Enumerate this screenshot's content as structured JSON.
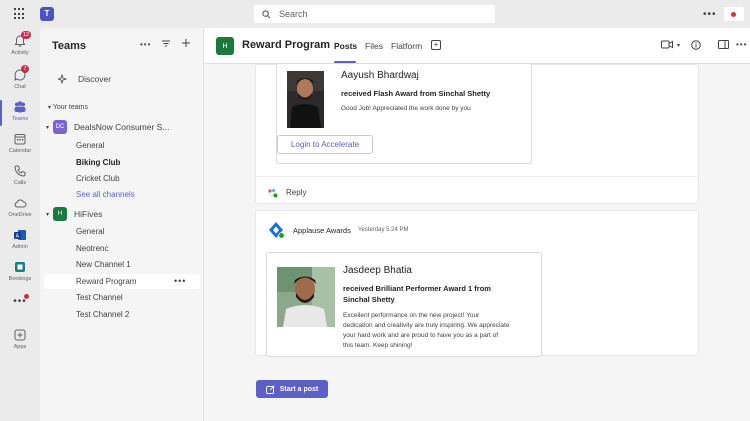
{
  "search": {
    "placeholder": "Search"
  },
  "rail": [
    {
      "label": "Activity",
      "badge": "12"
    },
    {
      "label": "Chat",
      "badge": "7"
    },
    {
      "label": "Teams"
    },
    {
      "label": "Calendar"
    },
    {
      "label": "Calls"
    },
    {
      "label": "OneDrive"
    },
    {
      "label": "Admin"
    },
    {
      "label": "Bookings"
    },
    {
      "label": "Apps"
    }
  ],
  "panel": {
    "title": "Teams",
    "discover": "Discover",
    "section_label": "Your teams",
    "teams": [
      {
        "name": "DealsNow Consumer S...",
        "initials": "DC",
        "color": "#7b61d6",
        "channels": [
          "General",
          "Biking Club",
          "Cricket Club",
          "See all channels"
        ]
      },
      {
        "name": "HiFives",
        "initials": "H",
        "color": "#1a7a3e",
        "channels": [
          "General",
          "Neotrenc",
          "New Channel 1",
          "Reward Program",
          "Test Channel",
          "Test Channel 2"
        ]
      }
    ]
  },
  "channel_header": {
    "initial": "H",
    "title": "Reward Program",
    "tabs": [
      "Posts",
      "Files",
      "Flatform"
    ]
  },
  "posts": [
    {
      "name": "Aayush Bhardwaj",
      "award_line": "received Flash Award from Sinchal Shetty",
      "message": "Good Job! Appreciated the work done by you",
      "button": "Login to Accelerate",
      "reply": "Reply"
    },
    {
      "app_name": "Applause Awards",
      "time": "Yesterday 5:24 PM",
      "name": "Jasdeep Bhatia",
      "award_line_1": "received Brilliant Performer Award 1 from",
      "award_line_2": "Sinchal Shetty",
      "message_lines": [
        "Excellent performance on the new project! Your",
        "dedication and creativity are truly inspiring. We appreciate",
        "your hard work and are proud to have you as a part of",
        "this team. Keep shining!"
      ]
    }
  ],
  "start_post": "Start a post",
  "colors": {
    "accent": "#5b5fc7",
    "badge": "#c4314b",
    "team_green": "#1a7a3e"
  }
}
